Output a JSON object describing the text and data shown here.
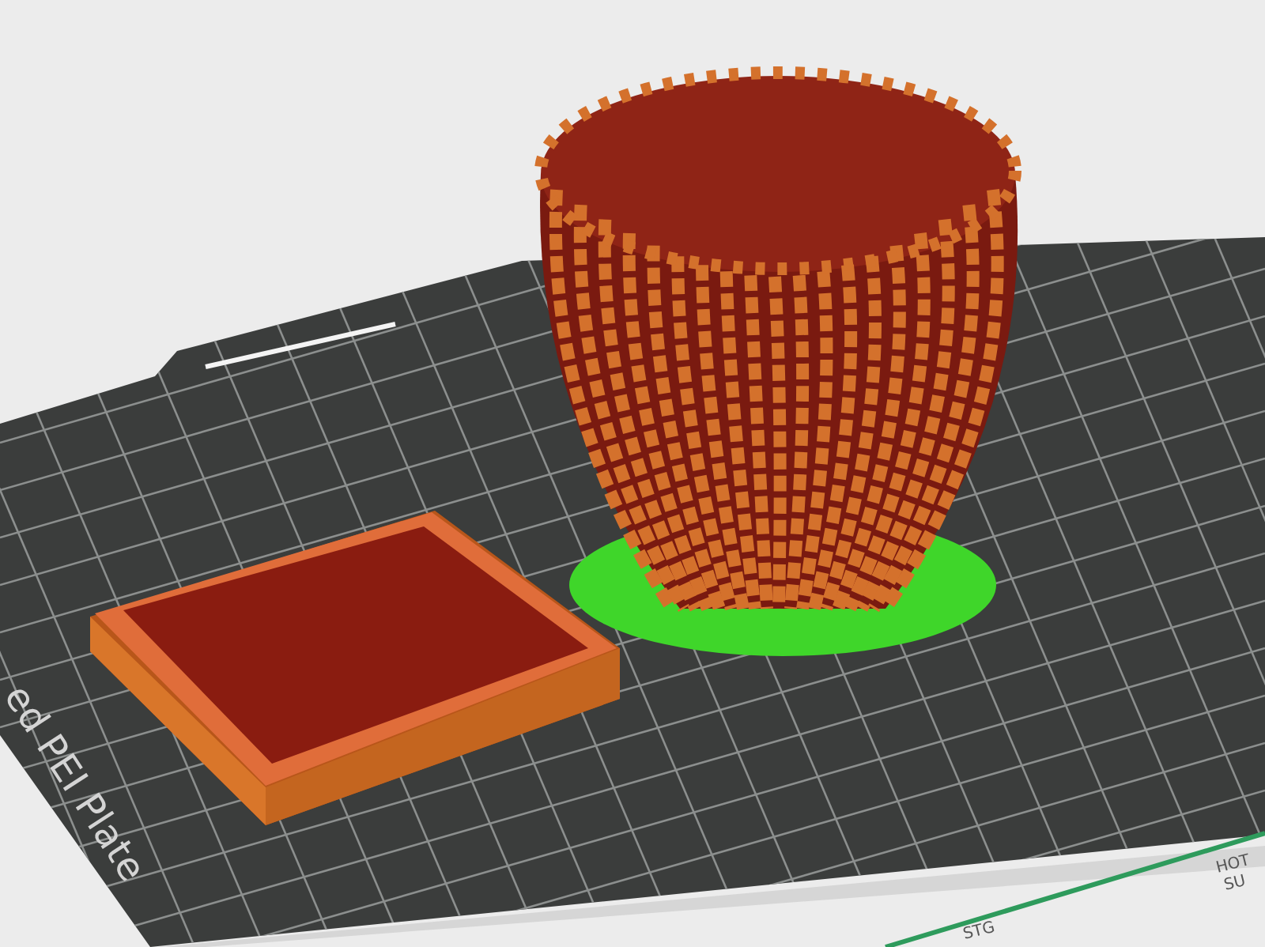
{
  "bed": {
    "plate_label": "ed PEI Plate",
    "front_labels": [
      "HOT",
      "SU",
      "STG"
    ]
  }
}
